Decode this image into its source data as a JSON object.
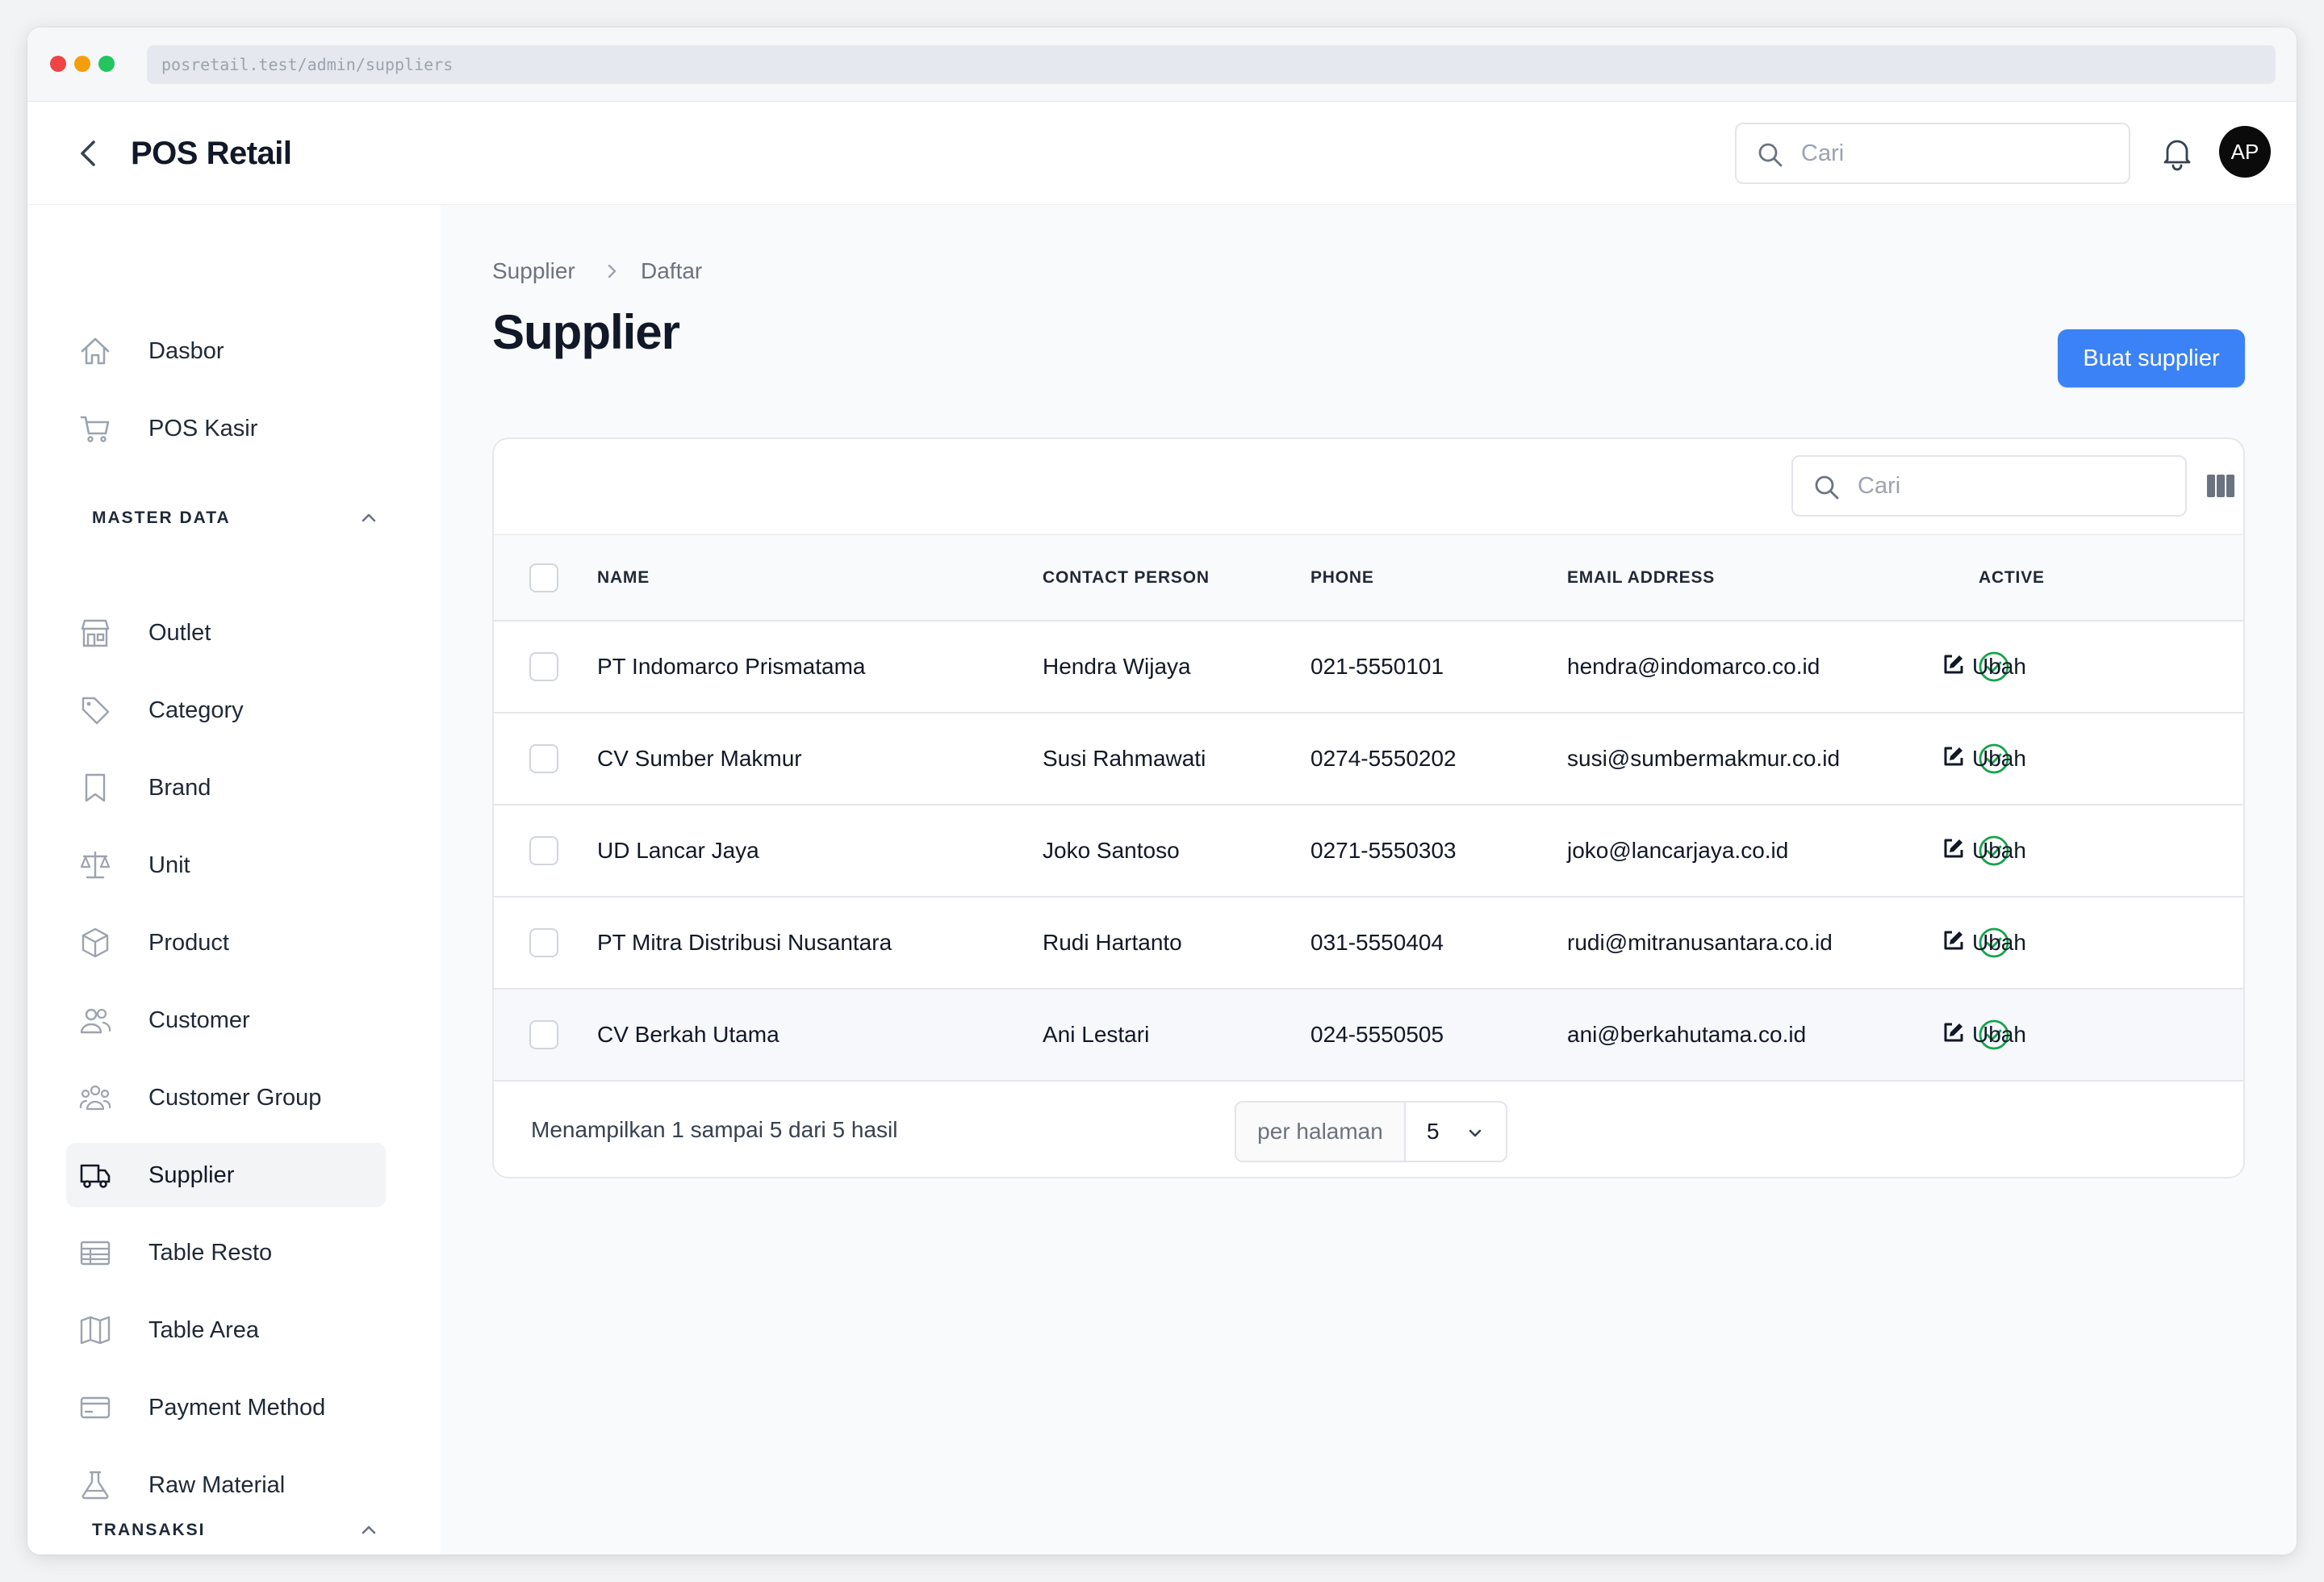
{
  "browser": {
    "url": "posretail.test/admin/suppliers"
  },
  "header": {
    "brand": "POS Retail",
    "search_placeholder": "Cari",
    "avatar_initials": "AP"
  },
  "sidebar": {
    "top_items": [
      {
        "label": "Dasbor",
        "icon": "home-icon"
      },
      {
        "label": "POS Kasir",
        "icon": "cart-icon"
      }
    ],
    "master_data_heading": "MASTER DATA",
    "master_items": [
      {
        "label": "Outlet",
        "icon": "store-icon"
      },
      {
        "label": "Category",
        "icon": "tag-icon"
      },
      {
        "label": "Brand",
        "icon": "bookmark-icon"
      },
      {
        "label": "Unit",
        "icon": "scale-icon"
      },
      {
        "label": "Product",
        "icon": "cube-icon"
      },
      {
        "label": "Customer",
        "icon": "users-icon"
      },
      {
        "label": "Customer Group",
        "icon": "user-group-icon"
      },
      {
        "label": "Supplier",
        "icon": "truck-icon",
        "active": true
      },
      {
        "label": "Table Resto",
        "icon": "table-icon"
      },
      {
        "label": "Table Area",
        "icon": "map-icon"
      },
      {
        "label": "Payment Method",
        "icon": "credit-card-icon"
      },
      {
        "label": "Raw Material",
        "icon": "beaker-icon"
      }
    ],
    "transaksi_heading": "TRANSAKSI"
  },
  "main": {
    "breadcrumb": [
      "Supplier",
      "Daftar"
    ],
    "title": "Supplier",
    "create_button": "Buat supplier",
    "table_search_placeholder": "Cari",
    "columns": [
      "NAME",
      "CONTACT PERSON",
      "PHONE",
      "EMAIL ADDRESS",
      "ACTIVE"
    ],
    "rows": [
      {
        "name": "PT Indomarco Prismatama",
        "contact": "Hendra Wijaya",
        "phone": "021-5550101",
        "email": "hendra@indomarco.co.id",
        "active": true,
        "action": "Ubah"
      },
      {
        "name": "CV Sumber Makmur",
        "contact": "Susi Rahmawati",
        "phone": "0274-5550202",
        "email": "susi@sumbermakmur.co.id",
        "active": true,
        "action": "Ubah"
      },
      {
        "name": "UD Lancar Jaya",
        "contact": "Joko Santoso",
        "phone": "0271-5550303",
        "email": "joko@lancarjaya.co.id",
        "active": true,
        "action": "Ubah"
      },
      {
        "name": "PT Mitra Distribusi Nusantara",
        "contact": "Rudi Hartanto",
        "phone": "031-5550404",
        "email": "rudi@mitranusantara.co.id",
        "active": true,
        "action": "Ubah"
      },
      {
        "name": "CV Berkah Utama",
        "contact": "Ani Lestari",
        "phone": "024-5550505",
        "email": "ani@berkahutama.co.id",
        "active": true,
        "action": "Ubah"
      }
    ],
    "footer": {
      "summary": "Menampilkan 1 sampai 5 dari 5 hasil",
      "per_page_label": "per halaman",
      "per_page_value": "5"
    }
  },
  "colors": {
    "accent": "#3b82f6",
    "active_green": "#16a34a",
    "sidebar_active_bg": "#f3f4f6"
  }
}
